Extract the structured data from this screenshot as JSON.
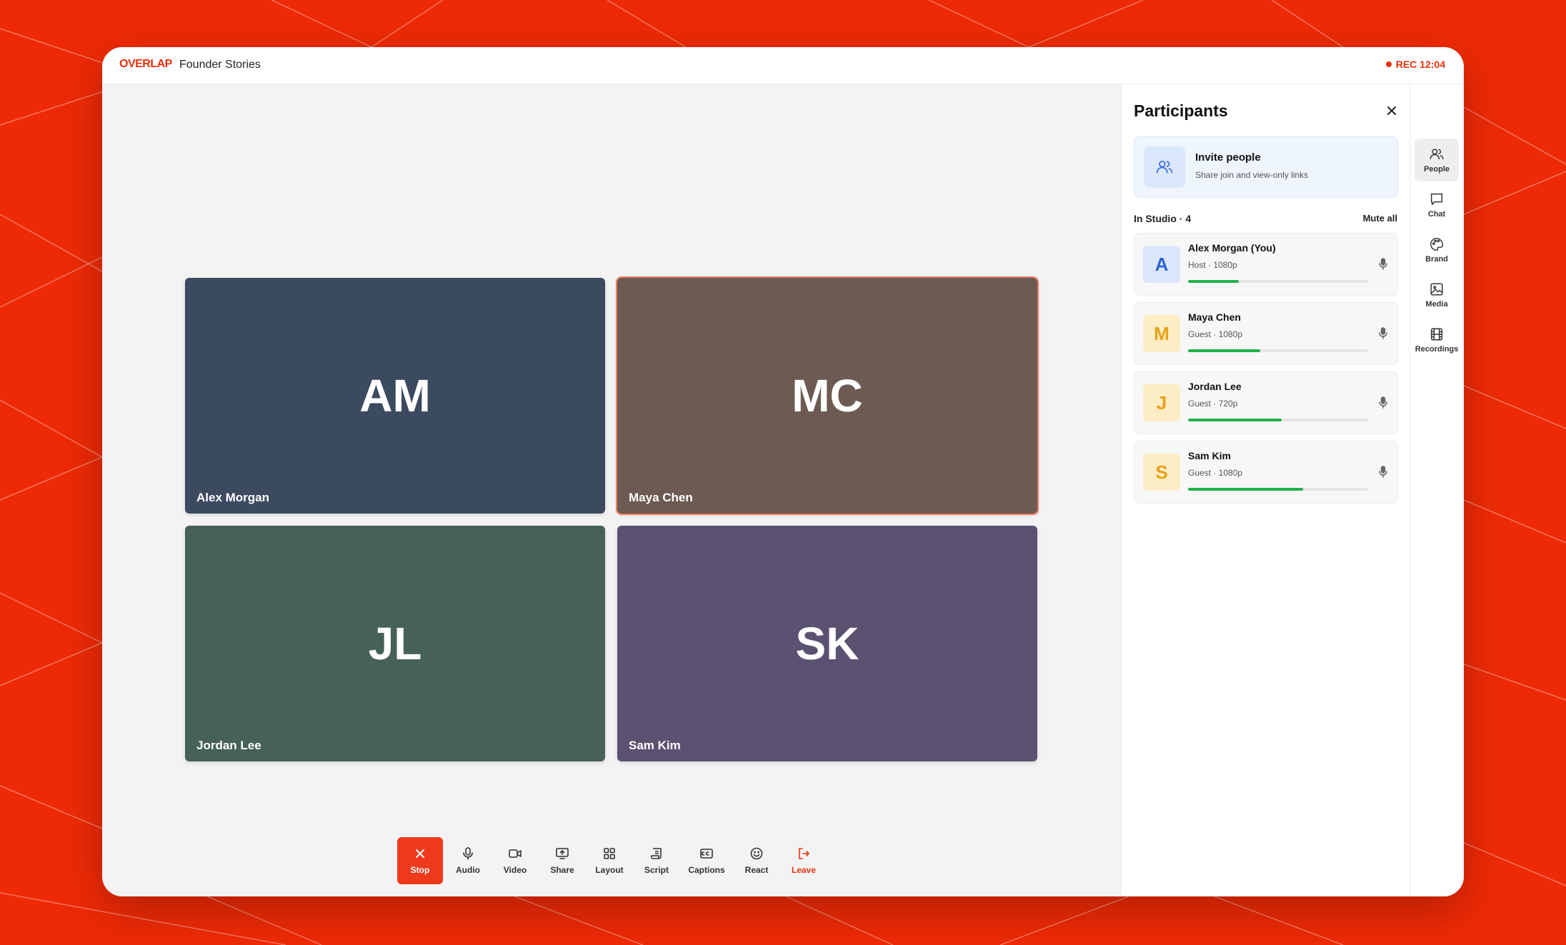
{
  "app": {
    "brand": "OVERLAP",
    "show_name": "Founder Stories",
    "rec_label": "REC 12:04"
  },
  "colors": {
    "brand_red": "#e8310c",
    "level_green": "#22b24c"
  },
  "stage": {
    "tiles": [
      {
        "initials": "AM",
        "name": "Alex Morgan",
        "color": "#3c4a60",
        "speaking": false
      },
      {
        "initials": "MC",
        "name": "Maya Chen",
        "color": "#6d5a53",
        "speaking": true
      },
      {
        "initials": "JL",
        "name": "Jordan Lee",
        "color": "#46605a",
        "speaking": false
      },
      {
        "initials": "SK",
        "name": "Sam Kim",
        "color": "#5b5170",
        "speaking": false
      }
    ]
  },
  "controls": {
    "stop": "Stop",
    "audio": "Audio",
    "video": "Video",
    "share": "Share",
    "layout": "Layout",
    "script": "Script",
    "captions": "Captions",
    "react": "React",
    "leave": "Leave"
  },
  "panel": {
    "title": "Participants",
    "invite_title": "Invite people",
    "invite_sub": "Share join and view-only links",
    "studio_head": "In Studio · 4",
    "mute_all": "Mute all",
    "participants": [
      {
        "initial": "A",
        "name": "Alex Morgan (You)",
        "meta": "Host · 1080p",
        "level": 0.28,
        "avatar_bg": "#dbe7fb",
        "avatar_fg": "#2f63d8"
      },
      {
        "initial": "M",
        "name": "Maya Chen",
        "meta": "Guest · 1080p",
        "level": 0.4,
        "avatar_bg": "#fdedc4",
        "avatar_fg": "#e7a21a"
      },
      {
        "initial": "J",
        "name": "Jordan Lee",
        "meta": "Guest · 720p",
        "level": 0.52,
        "avatar_bg": "#fdedc4",
        "avatar_fg": "#e7a21a"
      },
      {
        "initial": "S",
        "name": "Sam Kim",
        "meta": "Guest · 1080p",
        "level": 0.64,
        "avatar_bg": "#fdedc4",
        "avatar_fg": "#e7a21a"
      }
    ]
  },
  "rail": {
    "items": [
      {
        "label": "People",
        "icon": "people-icon",
        "active": true
      },
      {
        "label": "Chat",
        "icon": "chat-icon",
        "active": false
      },
      {
        "label": "Brand",
        "icon": "palette-icon",
        "active": false
      },
      {
        "label": "Media",
        "icon": "image-icon",
        "active": false
      },
      {
        "label": "Recordings",
        "icon": "film-icon",
        "active": false
      }
    ]
  }
}
